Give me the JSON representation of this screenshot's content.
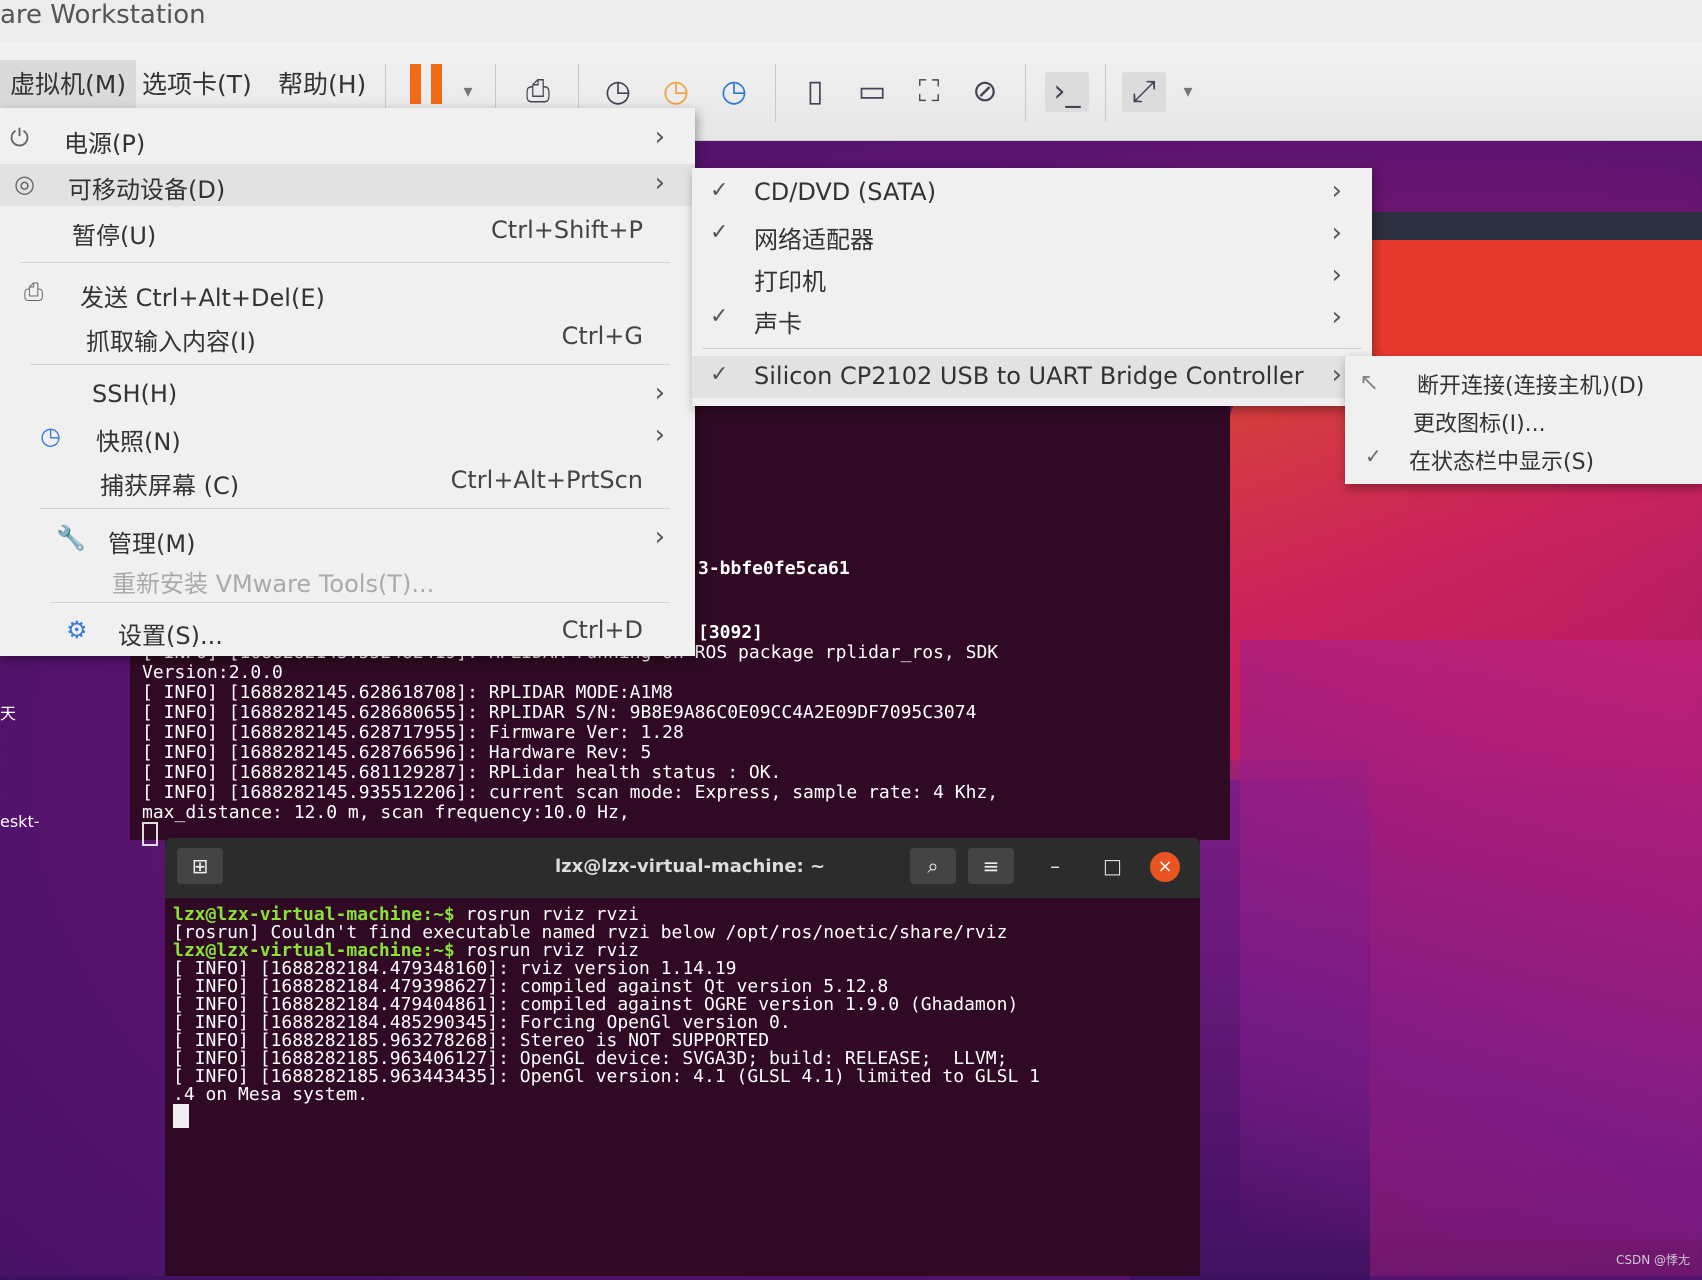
{
  "app": {
    "title": "are Workstation"
  },
  "toolbar": {
    "menus": [
      "虚拟机(M)",
      "选项卡(T)",
      "帮助(H)"
    ],
    "icons": [
      "pause-icon",
      "dropdown-icon",
      "send-keys-icon",
      "snapshot-icon",
      "revert-snapshot-icon",
      "snapshot-manager-icon",
      "sidebar-icon",
      "library-icon",
      "fullscreen-icon",
      "unity-icon",
      "console-icon",
      "stretch-icon",
      "dropdown-icon"
    ]
  },
  "vm_menu": {
    "power": "电源(P)",
    "removable": "可移动设备(D)",
    "pause": "暂停(U)",
    "pause_sc": "Ctrl+Shift+P",
    "send_cad": "发送 Ctrl+Alt+Del(E)",
    "grab": "抓取输入内容(I)",
    "grab_sc": "Ctrl+G",
    "ssh": "SSH(H)",
    "snapshot": "快照(N)",
    "capture": "捕获屏幕 (C)",
    "capture_sc": "Ctrl+Alt+PrtScn",
    "manage": "管理(M)",
    "reinstall": "重新安装 VMware Tools(T)...",
    "settings": "设置(S)...",
    "settings_sc": "Ctrl+D"
  },
  "devices_menu": {
    "cd": "CD/DVD (SATA)",
    "net": "网络适配器",
    "printer": "打印机",
    "sound": "声卡",
    "usb": "Silicon CP2102 USB to UART Bridge Controller"
  },
  "usb_menu": {
    "disconnect": "断开连接(连接主机)(D)",
    "change_icon": "更改图标(I)...",
    "show_status": "在状态栏中显示(S)"
  },
  "desktop": {
    "label1": "天",
    "label2": "eskt-"
  },
  "terminal1": {
    "partial1": "3-bbfe0fe5ca61",
    "partial2": "[3092]",
    "lines": [
      "[ INFO] [1688282145.552482419]: RPLIDAR running on ROS package rplidar_ros, SDK",
      "Version:2.0.0",
      "[ INFO] [1688282145.628618708]: RPLIDAR MODE:A1M8",
      "[ INFO] [1688282145.628680655]: RPLIDAR S/N: 9B8E9A86C0E09CC4A2E09DF7095C3074",
      "[ INFO] [1688282145.628717955]: Firmware Ver: 1.28",
      "[ INFO] [1688282145.628766596]: Hardware Rev: 5",
      "[ INFO] [1688282145.681129287]: RPLidar health status : OK.",
      "[ INFO] [1688282145.935512206]: current scan mode: Express, sample rate: 4 Khz,",
      "max_distance: 12.0 m, scan frequency:10.0 Hz,"
    ]
  },
  "terminal2": {
    "title": "lzx@lzx-virtual-machine: ~",
    "prompt": "lzx@lzx-virtual-machine:~$",
    "cmd1": " rosrun rviz rvzi",
    "err": "[rosrun] Couldn't find executable named rvzi below /opt/ros/noetic/share/rviz",
    "cmd2": " rosrun rviz rviz",
    "lines": [
      "[ INFO] [1688282184.479348160]: rviz version 1.14.19",
      "[ INFO] [1688282184.479398627]: compiled against Qt version 5.12.8",
      "[ INFO] [1688282184.479404861]: compiled against OGRE version 1.9.0 (Ghadamon)",
      "[ INFO] [1688282184.485290345]: Forcing OpenGl version 0.",
      "[ INFO] [1688282185.963278268]: Stereo is NOT SUPPORTED",
      "[ INFO] [1688282185.963406127]: OpenGL device: SVGA3D; build: RELEASE;  LLVM;",
      "[ INFO] [1688282185.963443435]: OpenGl version: 4.1 (GLSL 4.1) limited to GLSL 1",
      ".4 on Mesa system."
    ]
  },
  "watermark": "CSDN @悸尢"
}
